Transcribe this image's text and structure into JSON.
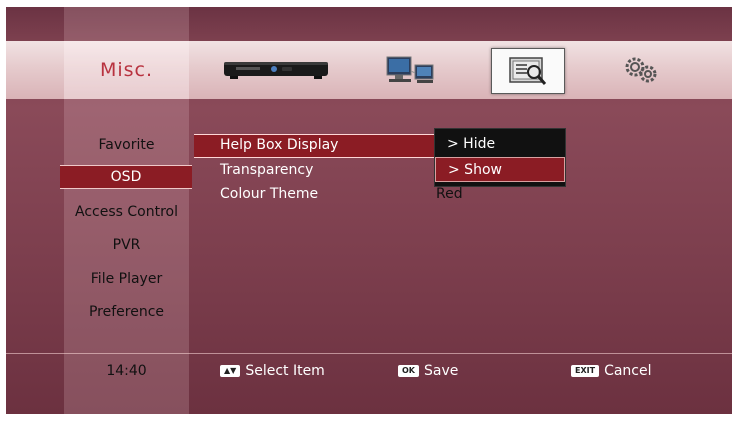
{
  "header": {
    "title": "Misc.",
    "icons": [
      {
        "name": "receiver-box-icon",
        "selected": false
      },
      {
        "name": "network-computer-icon",
        "selected": false
      },
      {
        "name": "monitor-settings-icon",
        "selected": true
      },
      {
        "name": "gears-icon",
        "selected": false
      }
    ]
  },
  "sidebar": {
    "items": [
      {
        "label": "Favorite",
        "active": false
      },
      {
        "label": "OSD",
        "active": true
      },
      {
        "label": "Access Control",
        "active": false
      },
      {
        "label": "PVR",
        "active": false
      },
      {
        "label": "File Player",
        "active": false
      },
      {
        "label": "Preference",
        "active": false
      }
    ]
  },
  "options": [
    {
      "label": "Help Box Display",
      "value": ""
    },
    {
      "label": "Transparency",
      "value": ""
    },
    {
      "label": "Colour Theme",
      "value": "Red"
    }
  ],
  "dropdown": {
    "items": [
      {
        "label": "> Hide",
        "selected": false
      },
      {
        "label": "> Show",
        "selected": true
      }
    ]
  },
  "footer": {
    "time": "14:40",
    "select_key": "▲▼",
    "select_label": "Select Item",
    "ok_key": "OK",
    "ok_label": "Save",
    "exit_key": "EXIT",
    "exit_label": "Cancel"
  },
  "colors": {
    "highlight": "#8b1c24",
    "title": "#b8323f",
    "background": "#7d404f"
  }
}
